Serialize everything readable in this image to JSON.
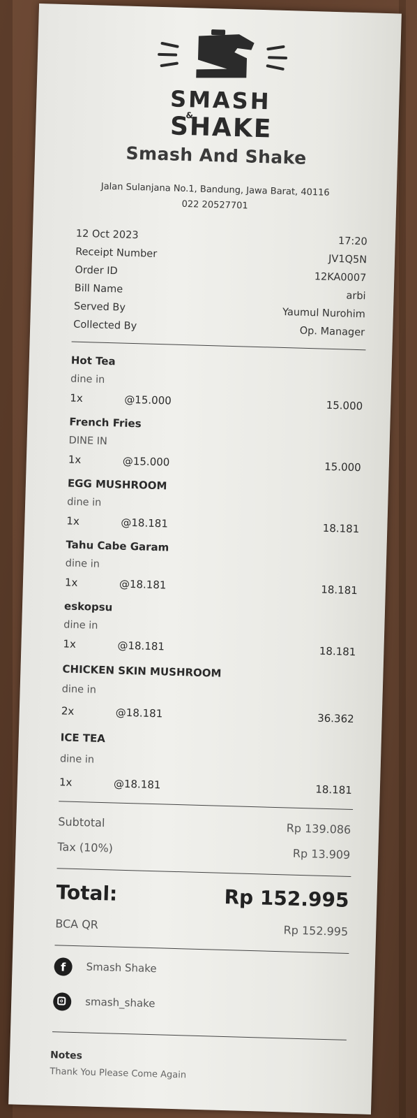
{
  "logo": {
    "line1": "SMASH",
    "line2": "SHAKE",
    "amp": "&"
  },
  "header": {
    "shop_name": "Smash And Shake",
    "address": "Jalan Sulanjana No.1, Bandung, Jawa Barat, 40116",
    "phone": "022 20527701"
  },
  "info": {
    "date": "12 Oct 2023",
    "time": "17:20",
    "receipt_label": "Receipt Number",
    "receipt_value": "JV1Q5N",
    "order_label": "Order ID",
    "order_value": "12KA0007",
    "bill_label": "Bill Name",
    "bill_value": "arbi",
    "served_label": "Served By",
    "served_value": "Yaumul Nurohim",
    "collected_label": "Collected By",
    "collected_value": "Op. Manager"
  },
  "items": [
    {
      "name": "Hot Tea",
      "mode": "dine in",
      "qty": "1x",
      "price": "@15.000",
      "amount": "15.000"
    },
    {
      "name": "French Fries",
      "mode": "DINE IN",
      "qty": "1x",
      "price": "@15.000",
      "amount": "15.000"
    },
    {
      "name": "EGG MUSHROOM",
      "mode": "dine in",
      "qty": "1x",
      "price": "@18.181",
      "amount": "18.181"
    },
    {
      "name": "Tahu Cabe Garam",
      "mode": "dine in",
      "qty": "1x",
      "price": "@18.181",
      "amount": "18.181"
    },
    {
      "name": "eskopsu",
      "mode": "dine in",
      "qty": "1x",
      "price": "@18.181",
      "amount": "18.181"
    },
    {
      "name": "CHICKEN SKIN MUSHROOM",
      "mode": "dine in",
      "qty": "2x",
      "price": "@18.181",
      "amount": "36.362"
    },
    {
      "name": "ICE TEA",
      "mode": "dine in",
      "qty": "1x",
      "price": "@18.181",
      "amount": "18.181"
    }
  ],
  "summary": {
    "subtotal_label": "Subtotal",
    "subtotal_value": "Rp 139.086",
    "tax_label": "Tax (10%)",
    "tax_value": "Rp 13.909",
    "total_label": "Total:",
    "total_value": "Rp 152.995",
    "payment_label": "BCA QR",
    "payment_value": "Rp 152.995"
  },
  "social": {
    "facebook_icon_glyph": "f",
    "facebook": "Smash Shake",
    "instagram": "smash_shake"
  },
  "notes": {
    "heading": "Notes",
    "text": "Thank You Please Come Again"
  },
  "colors": {
    "paper": "#ececE8",
    "ink": "#2a2a2a",
    "table": "#5d3d2b"
  }
}
